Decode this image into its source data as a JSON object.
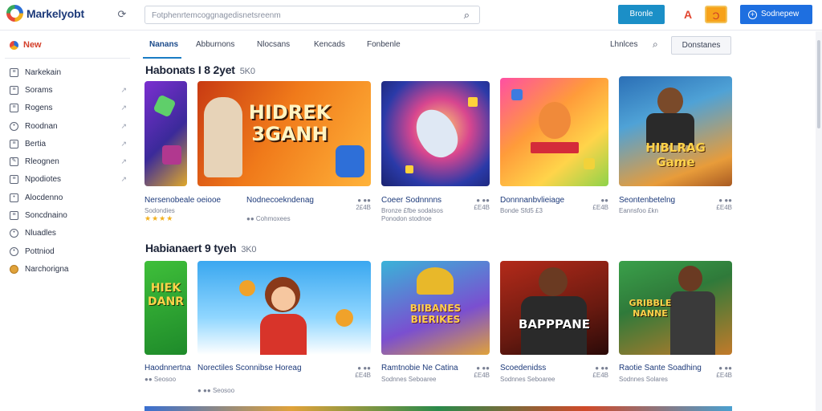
{
  "header": {
    "logo_text": "Markelyobt",
    "search_placeholder": "Fotphenrtemcoggnagedisnetsreenm",
    "teal_button": "Bronle",
    "icon_a": "A",
    "badge_glyph": "Ɔ",
    "blue_button": "Sodnepew"
  },
  "sidebar": {
    "new_label": "New",
    "items": [
      {
        "label": "Narkekain",
        "icon": "list-icon",
        "arrow": false
      },
      {
        "label": "Sorams",
        "icon": "doc-icon",
        "arrow": true
      },
      {
        "label": "Rogens",
        "icon": "doc-icon",
        "arrow": true
      },
      {
        "label": "Roodnan",
        "icon": "user-icon",
        "arrow": true
      },
      {
        "label": "Bertia",
        "icon": "doc-icon",
        "arrow": true
      },
      {
        "label": "Rleognen",
        "icon": "pencil-icon",
        "arrow": true
      },
      {
        "label": "Npodiotes",
        "icon": "doc-icon",
        "arrow": true
      },
      {
        "label": "Alocdenno",
        "icon": "bookmark-icon",
        "arrow": false
      },
      {
        "label": "Soncdnaino",
        "icon": "calendar-icon",
        "arrow": false
      },
      {
        "label": "Nluadles",
        "icon": "globe-icon",
        "arrow": false
      },
      {
        "label": "Pottniod",
        "icon": "globe-icon",
        "arrow": false
      },
      {
        "label": "Narchorigna",
        "icon": "avatar-icon",
        "arrow": false
      }
    ]
  },
  "tabs": {
    "items": [
      "Nanans",
      "Abburnons",
      "Nlocsans",
      "Kencads",
      "Fonbenle"
    ],
    "active": "Nanans",
    "right_label": "Lhnlces",
    "right_button": "Donstanes"
  },
  "sections": [
    {
      "title": "Habonats I 8 2yet",
      "count": "5K0",
      "cards": [
        {
          "name": "Nersenobeale oeiooe",
          "meta": "Sodondies",
          "price": "",
          "stars": "★★★★",
          "art": ""
        },
        {
          "name": "Nodnecoekndenag",
          "meta": "●● Cohmoxees",
          "price": "● ●●\n2£4B",
          "stars": "",
          "art": "HIDREK\n3GANH"
        },
        {
          "name": "Coeer Sodnnnns",
          "meta": "Bronze £fbe sodalsos\nPonodon stodnoe",
          "price": "● ●●\n£E4B",
          "stars": "",
          "art": ""
        },
        {
          "name": "Donnnanbvlieiage",
          "meta": "Bonde Sfd5 £3",
          "price": "●●\n£E4B",
          "stars": "",
          "art": ""
        },
        {
          "name": "Seontenbetelng",
          "meta": "Eannsfoo £kn",
          "price": "● ●●\n£E4B",
          "stars": "",
          "art": "HIBLRAG\nGame"
        }
      ]
    },
    {
      "title": "Habianaert 9 tyeh",
      "count": "3K0",
      "cards": [
        {
          "name": "Haodnnertna",
          "meta": "●● Seosoo",
          "price": "",
          "stars": "",
          "art": "HIEK\nDANR"
        },
        {
          "name": "Norectiles Sconnibse Horeag",
          "meta": "● ●● Seosoo",
          "price": "● ●●\n£E4B",
          "stars": "",
          "art": ""
        },
        {
          "name": "Ramtnobie Ne Catina",
          "meta": "Sodnnes Seboaree",
          "price": "● ●●\n£E4B",
          "stars": "",
          "art": "BIIBANES\nBIERIKES"
        },
        {
          "name": "Scoedenidss",
          "meta": "Sodnnes Seboaree",
          "price": "● ●●\n£E4B",
          "stars": "",
          "art": "BAPPPANE"
        },
        {
          "name": "Raotie Sante Soadhing",
          "meta": "Sodnnes Solares",
          "price": "● ●●\n£E4B",
          "stars": "",
          "art": "GRIBBLE\nNANNE"
        }
      ]
    }
  ],
  "colors": {
    "accent": "#1a7cc4",
    "primary_button": "#1e6fe0",
    "teal_button": "#1b8fc7",
    "new_label": "#d4402b",
    "link_text": "#1d3a7a"
  }
}
